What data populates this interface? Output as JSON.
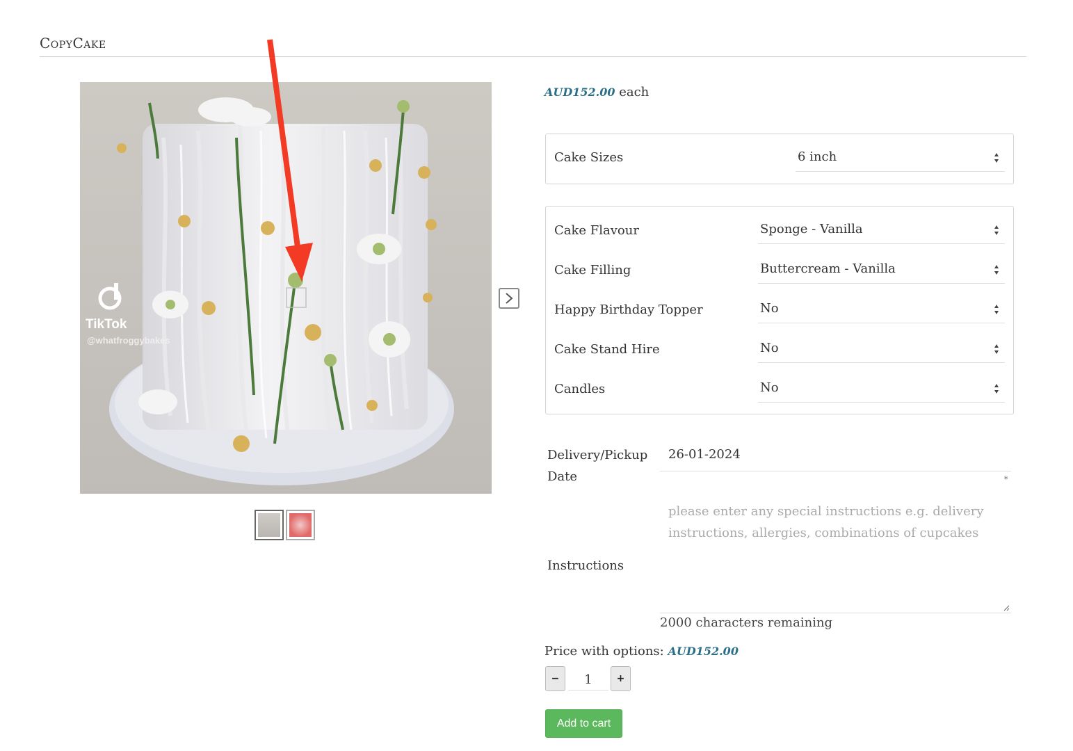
{
  "page": {
    "title": "CopyCake"
  },
  "gallery": {
    "watermark_brand": "TikTok",
    "watermark_handle": "@whatfroggybakes",
    "thumbnails": [
      "thumbnail-1",
      "thumbnail-2"
    ]
  },
  "product": {
    "price": "AUD152.00",
    "price_suffix": "each"
  },
  "options_primary": [
    {
      "label": "Cake Sizes",
      "value": "6 inch"
    }
  ],
  "options_secondary": [
    {
      "label": "Cake Flavour",
      "value": "Sponge - Vanilla"
    },
    {
      "label": "Cake Filling",
      "value": "Buttercream - Vanilla"
    },
    {
      "label": "Happy Birthday Topper",
      "value": "No"
    },
    {
      "label": "Cake Stand Hire",
      "value": "No"
    },
    {
      "label": "Candles",
      "value": "No"
    }
  ],
  "delivery": {
    "label_line1": "Delivery/Pickup",
    "label_line2": "Date",
    "value": "26-01-2024",
    "required_marker": "*"
  },
  "instructions": {
    "label": "Instructions",
    "placeholder": "please enter any special instructions e.g. delivery instructions, allergies, combinations of cupcakes",
    "remaining": "2000 characters remaining"
  },
  "totals": {
    "label": "Price with options:",
    "amount": "AUD152.00"
  },
  "quantity": {
    "minus": "−",
    "value": "1",
    "plus": "+"
  },
  "cart": {
    "label": "Add to cart"
  },
  "colors": {
    "accent_price": "#2a6f86",
    "cart_button": "#5cb85c",
    "annotation_arrow": "#f23a24"
  }
}
